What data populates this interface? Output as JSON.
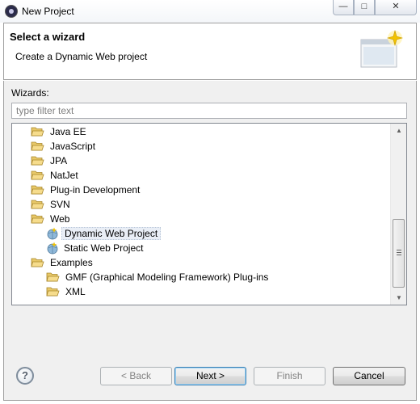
{
  "window": {
    "title": "New Project",
    "controls": {
      "minimize": "—",
      "maximize": "□",
      "close": "✕"
    }
  },
  "banner": {
    "title": "Select a wizard",
    "description": "Create a Dynamic Web project"
  },
  "wizards_label": "Wizards:",
  "filter": {
    "placeholder": "type filter text",
    "value": ""
  },
  "tree": {
    "items": [
      {
        "label": "Java EE",
        "type": "folder",
        "level": 1
      },
      {
        "label": "JavaScript",
        "type": "folder",
        "level": 1
      },
      {
        "label": "JPA",
        "type": "folder",
        "level": 1
      },
      {
        "label": "NatJet",
        "type": "folder",
        "level": 1
      },
      {
        "label": "Plug-in Development",
        "type": "folder",
        "level": 1
      },
      {
        "label": "SVN",
        "type": "folder",
        "level": 1
      },
      {
        "label": "Web",
        "type": "folder",
        "level": 1,
        "expanded": true
      },
      {
        "label": "Dynamic Web Project",
        "type": "project",
        "level": 2,
        "selected": true
      },
      {
        "label": "Static Web Project",
        "type": "project",
        "level": 2
      },
      {
        "label": "Examples",
        "type": "folder",
        "level": 1,
        "expanded": true
      },
      {
        "label": "GMF (Graphical Modeling Framework) Plug-ins",
        "type": "folder",
        "level": 2
      },
      {
        "label": "XML",
        "type": "folder",
        "level": 2
      }
    ]
  },
  "buttons": {
    "help": "?",
    "back": "< Back",
    "next": "Next >",
    "finish": "Finish",
    "cancel": "Cancel"
  },
  "colors": {
    "folder": "#e8c868",
    "selection": "#e9eef6",
    "default_button_border": "#3c7fb1"
  }
}
